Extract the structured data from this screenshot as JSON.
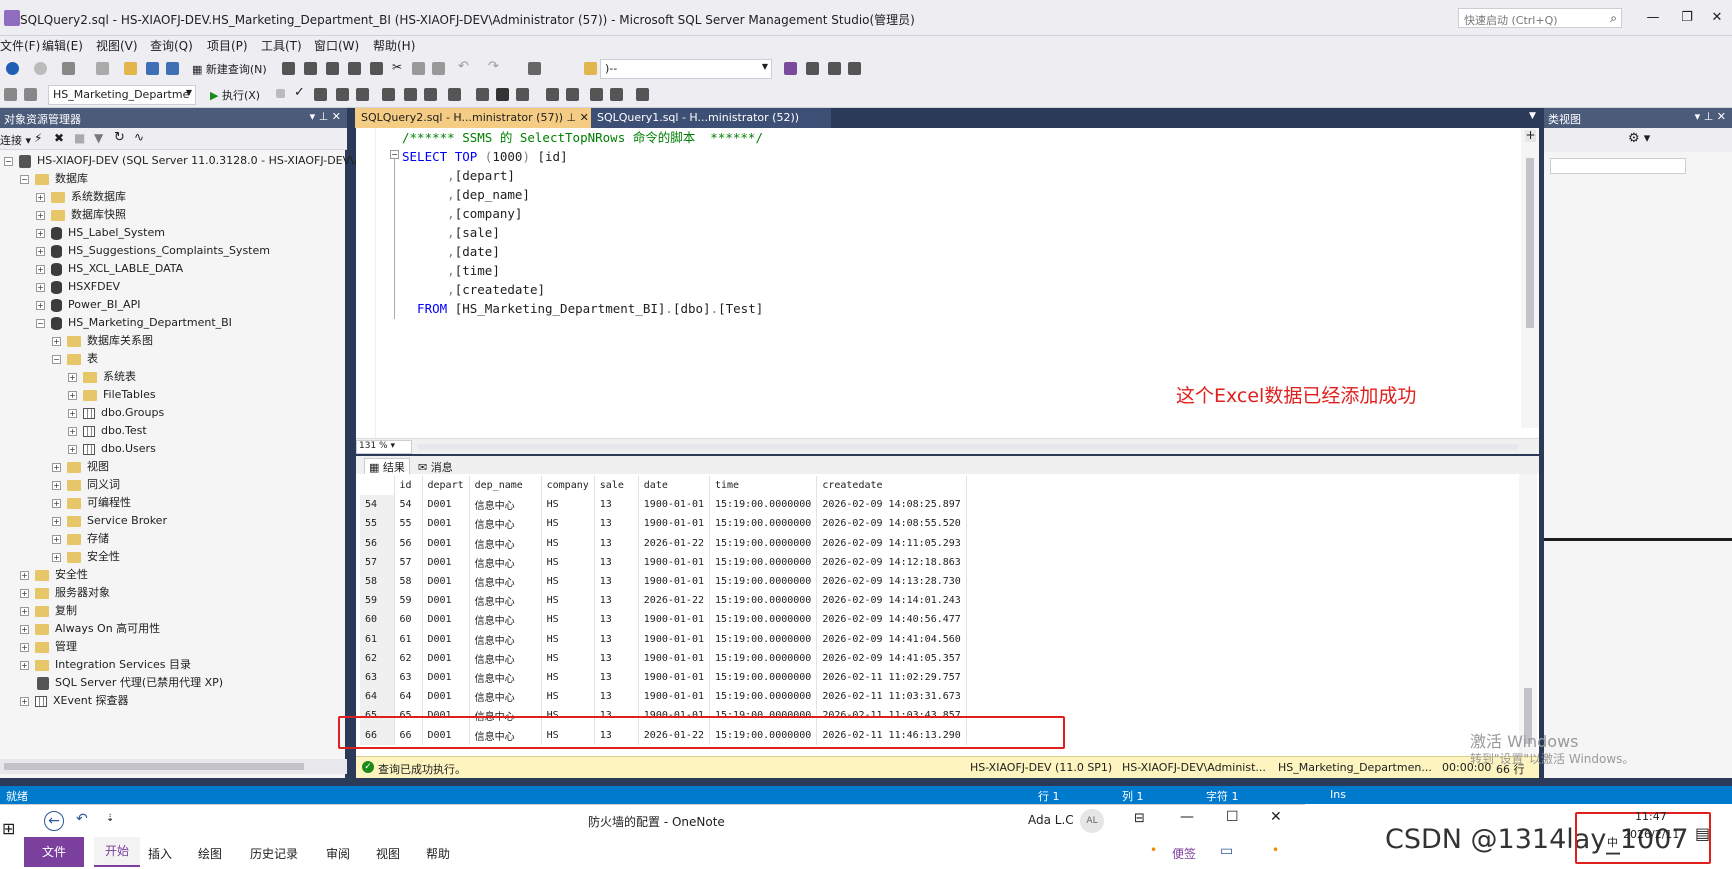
{
  "window": {
    "title": "SQLQuery2.sql - HS-XIAOFJ-DEV.HS_Marketing_Department_BI (HS-XIAOFJ-DEV\\Administrator (57)) - Microsoft SQL Server Management Studio(管理员)",
    "quick_launch": "快速启动 (Ctrl+Q)"
  },
  "menu": [
    "文件(F)",
    "编辑(E)",
    "视图(V)",
    "查询(Q)",
    "项目(P)",
    "工具(T)",
    "窗口(W)",
    "帮助(H)"
  ],
  "toolbar": {
    "new_query": "新建查询(N)",
    "search_combo": ")--",
    "database_combo": "HS_Marketing_Departme",
    "execute": "执行(X)"
  },
  "object_explorer": {
    "title": "对象资源管理器",
    "connect": "连接",
    "tree": [
      {
        "label": "HS-XIAOFJ-DEV (SQL Server 11.0.3128.0 - HS-XIAOFJ-DEV\\A",
        "level": 0,
        "icon": "server-icon",
        "exp": "-"
      },
      {
        "label": "数据库",
        "level": 1,
        "icon": "folder-icon",
        "exp": "-"
      },
      {
        "label": "系统数据库",
        "level": 2,
        "icon": "folder-icon",
        "exp": "+"
      },
      {
        "label": "数据库快照",
        "level": 2,
        "icon": "folder-icon",
        "exp": "+"
      },
      {
        "label": "HS_Label_System",
        "level": 2,
        "icon": "database-icon",
        "exp": "+"
      },
      {
        "label": "HS_Suggestions_Complaints_System",
        "level": 2,
        "icon": "database-icon",
        "exp": "+"
      },
      {
        "label": "HS_XCL_LABLE_DATA",
        "level": 2,
        "icon": "database-icon",
        "exp": "+"
      },
      {
        "label": "HSXFDEV",
        "level": 2,
        "icon": "database-icon",
        "exp": "+"
      },
      {
        "label": "Power_BI_API",
        "level": 2,
        "icon": "database-icon",
        "exp": "+"
      },
      {
        "label": "HS_Marketing_Department_BI",
        "level": 2,
        "icon": "database-icon",
        "exp": "-"
      },
      {
        "label": "数据库关系图",
        "level": 3,
        "icon": "folder-icon",
        "exp": "+"
      },
      {
        "label": "表",
        "level": 3,
        "icon": "folder-icon",
        "exp": "-"
      },
      {
        "label": "系统表",
        "level": 4,
        "icon": "folder-icon",
        "exp": "+"
      },
      {
        "label": "FileTables",
        "level": 4,
        "icon": "folder-icon",
        "exp": "+"
      },
      {
        "label": "dbo.Groups",
        "level": 4,
        "icon": "table-icon",
        "exp": "+"
      },
      {
        "label": "dbo.Test",
        "level": 4,
        "icon": "table-icon",
        "exp": "+"
      },
      {
        "label": "dbo.Users",
        "level": 4,
        "icon": "table-icon",
        "exp": "+"
      },
      {
        "label": "视图",
        "level": 3,
        "icon": "folder-icon",
        "exp": "+"
      },
      {
        "label": "同义词",
        "level": 3,
        "icon": "folder-icon",
        "exp": "+"
      },
      {
        "label": "可编程性",
        "level": 3,
        "icon": "folder-icon",
        "exp": "+"
      },
      {
        "label": "Service Broker",
        "level": 3,
        "icon": "folder-icon",
        "exp": "+"
      },
      {
        "label": "存储",
        "level": 3,
        "icon": "folder-icon",
        "exp": "+"
      },
      {
        "label": "安全性",
        "level": 3,
        "icon": "folder-icon",
        "exp": "+"
      },
      {
        "label": "安全性",
        "level": 1,
        "icon": "folder-icon",
        "exp": "+"
      },
      {
        "label": "服务器对象",
        "level": 1,
        "icon": "folder-icon",
        "exp": "+"
      },
      {
        "label": "复制",
        "level": 1,
        "icon": "folder-icon",
        "exp": "+"
      },
      {
        "label": "Always On 高可用性",
        "level": 1,
        "icon": "folder-icon",
        "exp": "+"
      },
      {
        "label": "管理",
        "level": 1,
        "icon": "folder-icon",
        "exp": "+"
      },
      {
        "label": "Integration Services 目录",
        "level": 1,
        "icon": "folder-icon",
        "exp": "+"
      },
      {
        "label": "SQL Server 代理(已禁用代理 XP)",
        "level": 1,
        "icon": "agent-icon",
        "exp": ""
      },
      {
        "label": "XEvent 探查器",
        "level": 1,
        "icon": "xevent-icon",
        "exp": "+"
      }
    ]
  },
  "tabs": [
    {
      "label": "SQLQuery2.sql - H...ministrator (57))",
      "active": true
    },
    {
      "label": "SQLQuery1.sql - H...ministrator (52))",
      "active": false
    }
  ],
  "editor": {
    "lines": [
      [
        {
          "t": "/****** SSMS 的 SelectTopNRows 命令的脚本  ******/",
          "c": "cm"
        }
      ],
      [
        {
          "t": "SELECT ",
          "c": "kw"
        },
        {
          "t": "TOP ",
          "c": "kw"
        },
        {
          "t": "(",
          "c": "gr"
        },
        {
          "t": "1000",
          "c": ""
        },
        {
          "t": ") ",
          "c": "gr"
        },
        {
          "t": "[id]",
          "c": ""
        }
      ],
      [
        {
          "t": "      ,",
          "c": "gr"
        },
        {
          "t": "[depart]",
          "c": ""
        }
      ],
      [
        {
          "t": "      ,",
          "c": "gr"
        },
        {
          "t": "[dep_name]",
          "c": ""
        }
      ],
      [
        {
          "t": "      ,",
          "c": "gr"
        },
        {
          "t": "[company]",
          "c": ""
        }
      ],
      [
        {
          "t": "      ,",
          "c": "gr"
        },
        {
          "t": "[sale]",
          "c": ""
        }
      ],
      [
        {
          "t": "      ,",
          "c": "gr"
        },
        {
          "t": "[date]",
          "c": ""
        }
      ],
      [
        {
          "t": "      ,",
          "c": "gr"
        },
        {
          "t": "[time]",
          "c": ""
        }
      ],
      [
        {
          "t": "      ,",
          "c": "gr"
        },
        {
          "t": "[createdate]",
          "c": ""
        }
      ],
      [
        {
          "t": "  FROM ",
          "c": "kw"
        },
        {
          "t": "[HS_Marketing_Department_BI]",
          "c": ""
        },
        {
          "t": ".",
          "c": "gr"
        },
        {
          "t": "[dbo]",
          "c": ""
        },
        {
          "t": ".",
          "c": "gr"
        },
        {
          "t": "[Test]",
          "c": ""
        }
      ]
    ],
    "annotation": "这个Excel数据已经添加成功",
    "zoom": "131 %"
  },
  "result_tabs": {
    "results": "结果",
    "messages": "消息"
  },
  "results": {
    "columns": [
      "id",
      "depart",
      "dep_name",
      "company",
      "sale",
      "date",
      "time",
      "createdate"
    ],
    "rows": [
      [
        "54",
        "54",
        "D001",
        "信息中心",
        "HS",
        "13",
        "1900-01-01",
        "15:19:00.0000000",
        "2026-02-09 14:08:25.897"
      ],
      [
        "55",
        "55",
        "D001",
        "信息中心",
        "HS",
        "13",
        "1900-01-01",
        "15:19:00.0000000",
        "2026-02-09 14:08:55.520"
      ],
      [
        "56",
        "56",
        "D001",
        "信息中心",
        "HS",
        "13",
        "2026-01-22",
        "15:19:00.0000000",
        "2026-02-09 14:11:05.293"
      ],
      [
        "57",
        "57",
        "D001",
        "信息中心",
        "HS",
        "13",
        "1900-01-01",
        "15:19:00.0000000",
        "2026-02-09 14:12:18.863"
      ],
      [
        "58",
        "58",
        "D001",
        "信息中心",
        "HS",
        "13",
        "1900-01-01",
        "15:19:00.0000000",
        "2026-02-09 14:13:28.730"
      ],
      [
        "59",
        "59",
        "D001",
        "信息中心",
        "HS",
        "13",
        "2026-01-22",
        "15:19:00.0000000",
        "2026-02-09 14:14:01.243"
      ],
      [
        "60",
        "60",
        "D001",
        "信息中心",
        "HS",
        "13",
        "1900-01-01",
        "15:19:00.0000000",
        "2026-02-09 14:40:56.477"
      ],
      [
        "61",
        "61",
        "D001",
        "信息中心",
        "HS",
        "13",
        "1900-01-01",
        "15:19:00.0000000",
        "2026-02-09 14:41:04.560"
      ],
      [
        "62",
        "62",
        "D001",
        "信息中心",
        "HS",
        "13",
        "1900-01-01",
        "15:19:00.0000000",
        "2026-02-09 14:41:05.357"
      ],
      [
        "63",
        "63",
        "D001",
        "信息中心",
        "HS",
        "13",
        "1900-01-01",
        "15:19:00.0000000",
        "2026-02-11 11:02:29.757"
      ],
      [
        "64",
        "64",
        "D001",
        "信息中心",
        "HS",
        "13",
        "1900-01-01",
        "15:19:00.0000000",
        "2026-02-11 11:03:31.673"
      ],
      [
        "65",
        "65",
        "D001",
        "信息中心",
        "HS",
        "13",
        "1900-01-01",
        "15:19:00.0000000",
        "2026-02-11 11:03:43.857"
      ],
      [
        "66",
        "66",
        "D001",
        "信息中心",
        "HS",
        "13",
        "2026-01-22",
        "15:19:00.0000000",
        "2026-02-11 11:46:13.290"
      ]
    ]
  },
  "status": {
    "message": "查询已成功执行。",
    "server": "HS-XIAOFJ-DEV (11.0 SP1)",
    "user": "HS-XIAOFJ-DEV\\Administ...",
    "database": "HS_Marketing_Departmen...",
    "elapsed": "00:00:00",
    "rows": "66 行"
  },
  "statusbar": {
    "ready": "就绪",
    "line": "行 1",
    "col": "列 1",
    "char": "字符 1",
    "ins": "Ins"
  },
  "class_view": {
    "title": "类视图"
  },
  "activate": {
    "line1": "激活 Windows",
    "line2": "转到\"设置\"以激活 Windows。"
  },
  "onenote": {
    "title": "防火墙的配置  -  OneNote",
    "user": "Ada L.C",
    "avatar": "AL",
    "tabs": [
      "文件",
      "开始",
      "插入",
      "绘图",
      "历史记录",
      "审阅",
      "视图",
      "帮助"
    ],
    "sticky": "便签"
  },
  "taskbar": {
    "time": "11:47",
    "date": "2026/2/11",
    "ime": "中"
  },
  "watermark_credit": "CSDN @1314lay_1007",
  "colors": {
    "highlight_box": "#e0201e",
    "annotation_text": "#e0201e",
    "accent_blue": "#007acc",
    "tab_active": "#f5cc84"
  }
}
